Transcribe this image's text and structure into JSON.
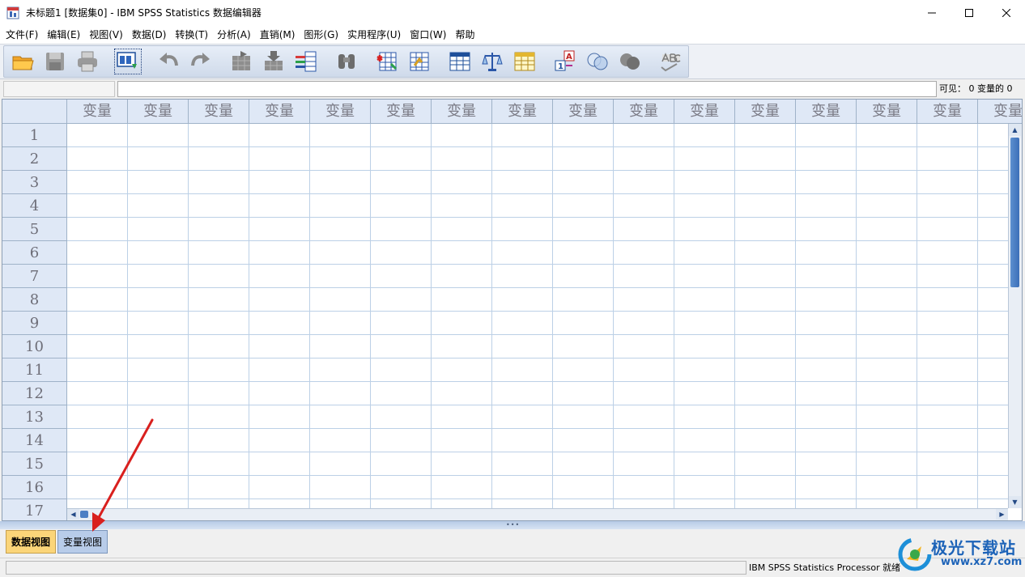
{
  "window": {
    "title": "未标题1 [数据集0] - IBM SPSS Statistics 数据编辑器"
  },
  "menu": [
    "文件(F)",
    "编辑(E)",
    "视图(V)",
    "数据(D)",
    "转换(T)",
    "分析(A)",
    "直销(M)",
    "图形(G)",
    "实用程序(U)",
    "窗口(W)",
    "帮助"
  ],
  "toolbar": {
    "buttons": [
      {
        "name": "open-icon"
      },
      {
        "name": "save-icon"
      },
      {
        "name": "print-icon"
      },
      {
        "name": "dialog-recall-icon"
      },
      {
        "name": "undo-icon"
      },
      {
        "name": "redo-icon"
      },
      {
        "name": "goto-case-icon"
      },
      {
        "name": "goto-variable-icon"
      },
      {
        "name": "variables-icon"
      },
      {
        "name": "find-icon"
      },
      {
        "name": "insert-cases-icon"
      },
      {
        "name": "insert-variable-icon"
      },
      {
        "name": "split-file-icon"
      },
      {
        "name": "weight-cases-icon"
      },
      {
        "name": "select-cases-icon"
      },
      {
        "name": "value-labels-icon"
      },
      {
        "name": "use-sets-icon"
      },
      {
        "name": "show-all-variables-icon"
      },
      {
        "name": "spell-check-icon"
      }
    ]
  },
  "editor": {
    "visible_info": "可见： 0 变量的 0"
  },
  "grid": {
    "column_headers": [
      "变量",
      "变量",
      "变量",
      "变量",
      "变量",
      "变量",
      "变量",
      "变量",
      "变量",
      "变量",
      "变量",
      "变量",
      "变量",
      "变量",
      "变量",
      "变量"
    ],
    "row_headers": [
      "1",
      "2",
      "3",
      "4",
      "5",
      "6",
      "7",
      "8",
      "9",
      "10",
      "11",
      "12",
      "13",
      "14",
      "15",
      "16",
      "17"
    ]
  },
  "tabs": {
    "data_view": "数据视图",
    "variable_view": "变量视图",
    "active": "数据视图"
  },
  "status": {
    "processor": "IBM SPSS Statistics Processor 就绪"
  },
  "watermark": {
    "text": "极光下载站",
    "url": "www.xz7.com"
  },
  "colors": {
    "header_bg": "#dfe8f6",
    "gridline": "#bcd0e6",
    "active_tab": "#fbd579",
    "inactive_tab": "#b8cce9",
    "annotation_arrow": "#d9201e"
  }
}
